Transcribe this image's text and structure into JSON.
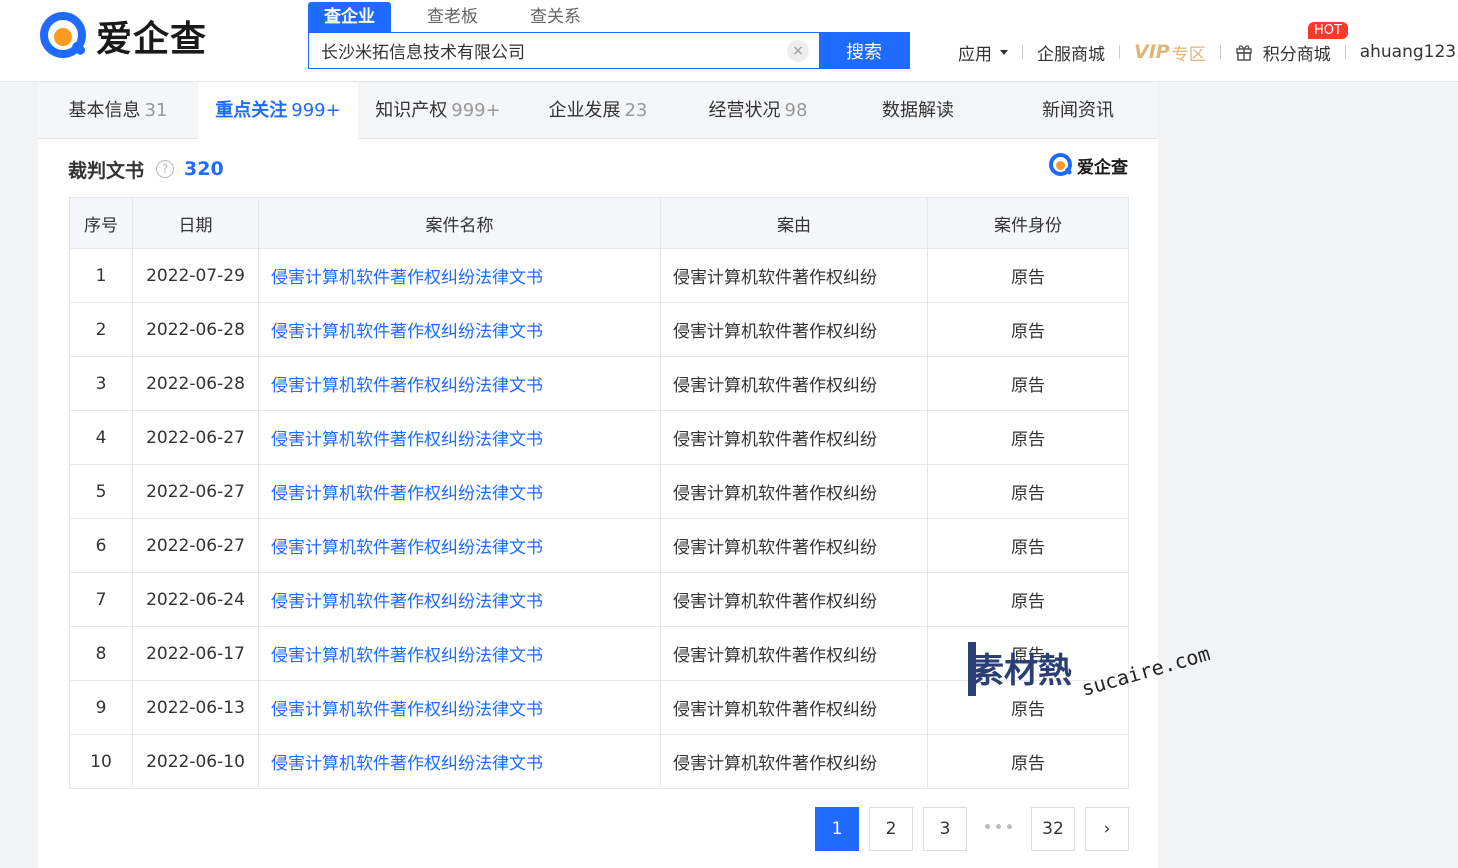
{
  "header": {
    "logo_text": "爱企查",
    "search_tabs": [
      "查企业",
      "查老板",
      "查关系"
    ],
    "search_value": "长沙米拓信息技术有限公司",
    "search_button": "搜索",
    "nav": {
      "apps": "应用",
      "mall": "企服商城",
      "vip": "VIP",
      "vip_zone": "专区",
      "points_mall": "积分商城",
      "hot": "HOT",
      "user": "ahuang123."
    }
  },
  "tabs": [
    {
      "label": "基本信息",
      "count": "31"
    },
    {
      "label": "重点关注",
      "count": "999+"
    },
    {
      "label": "知识产权",
      "count": "999+"
    },
    {
      "label": "企业发展",
      "count": "23"
    },
    {
      "label": "经营状况",
      "count": "98"
    },
    {
      "label": "数据解读",
      "count": ""
    },
    {
      "label": "新闻资讯",
      "count": ""
    }
  ],
  "section": {
    "title": "裁判文书",
    "count": "320",
    "logo_text": "爱企查"
  },
  "table": {
    "headers": [
      "序号",
      "日期",
      "案件名称",
      "案由",
      "案件身份"
    ],
    "rows": [
      {
        "no": "1",
        "date": "2022-07-29",
        "name": "侵害计算机软件著作权纠纷法律文书",
        "cause": "侵害计算机软件著作权纠纷",
        "role": "原告"
      },
      {
        "no": "2",
        "date": "2022-06-28",
        "name": "侵害计算机软件著作权纠纷法律文书",
        "cause": "侵害计算机软件著作权纠纷",
        "role": "原告"
      },
      {
        "no": "3",
        "date": "2022-06-28",
        "name": "侵害计算机软件著作权纠纷法律文书",
        "cause": "侵害计算机软件著作权纠纷",
        "role": "原告"
      },
      {
        "no": "4",
        "date": "2022-06-27",
        "name": "侵害计算机软件著作权纠纷法律文书",
        "cause": "侵害计算机软件著作权纠纷",
        "role": "原告"
      },
      {
        "no": "5",
        "date": "2022-06-27",
        "name": "侵害计算机软件著作权纠纷法律文书",
        "cause": "侵害计算机软件著作权纠纷",
        "role": "原告"
      },
      {
        "no": "6",
        "date": "2022-06-27",
        "name": "侵害计算机软件著作权纠纷法律文书",
        "cause": "侵害计算机软件著作权纠纷",
        "role": "原告"
      },
      {
        "no": "7",
        "date": "2022-06-24",
        "name": "侵害计算机软件著作权纠纷法律文书",
        "cause": "侵害计算机软件著作权纠纷",
        "role": "原告"
      },
      {
        "no": "8",
        "date": "2022-06-17",
        "name": "侵害计算机软件著作权纠纷法律文书",
        "cause": "侵害计算机软件著作权纠纷",
        "role": "原告"
      },
      {
        "no": "9",
        "date": "2022-06-13",
        "name": "侵害计算机软件著作权纠纷法律文书",
        "cause": "侵害计算机软件著作权纠纷",
        "role": "原告"
      },
      {
        "no": "10",
        "date": "2022-06-10",
        "name": "侵害计算机软件著作权纠纷法律文书",
        "cause": "侵害计算机软件著作权纠纷",
        "role": "原告"
      }
    ]
  },
  "pagination": {
    "pages": [
      "1",
      "2",
      "3"
    ],
    "ellipsis": "•••",
    "last": "32",
    "next": "›"
  },
  "watermark": {
    "cn": "素材熱",
    "en": "sucaire.com"
  },
  "colors": {
    "accent": "#1f6bff",
    "vip": "#e0b57a",
    "hot": "#f33c2d",
    "logo_orange": "#ff9a1f"
  }
}
